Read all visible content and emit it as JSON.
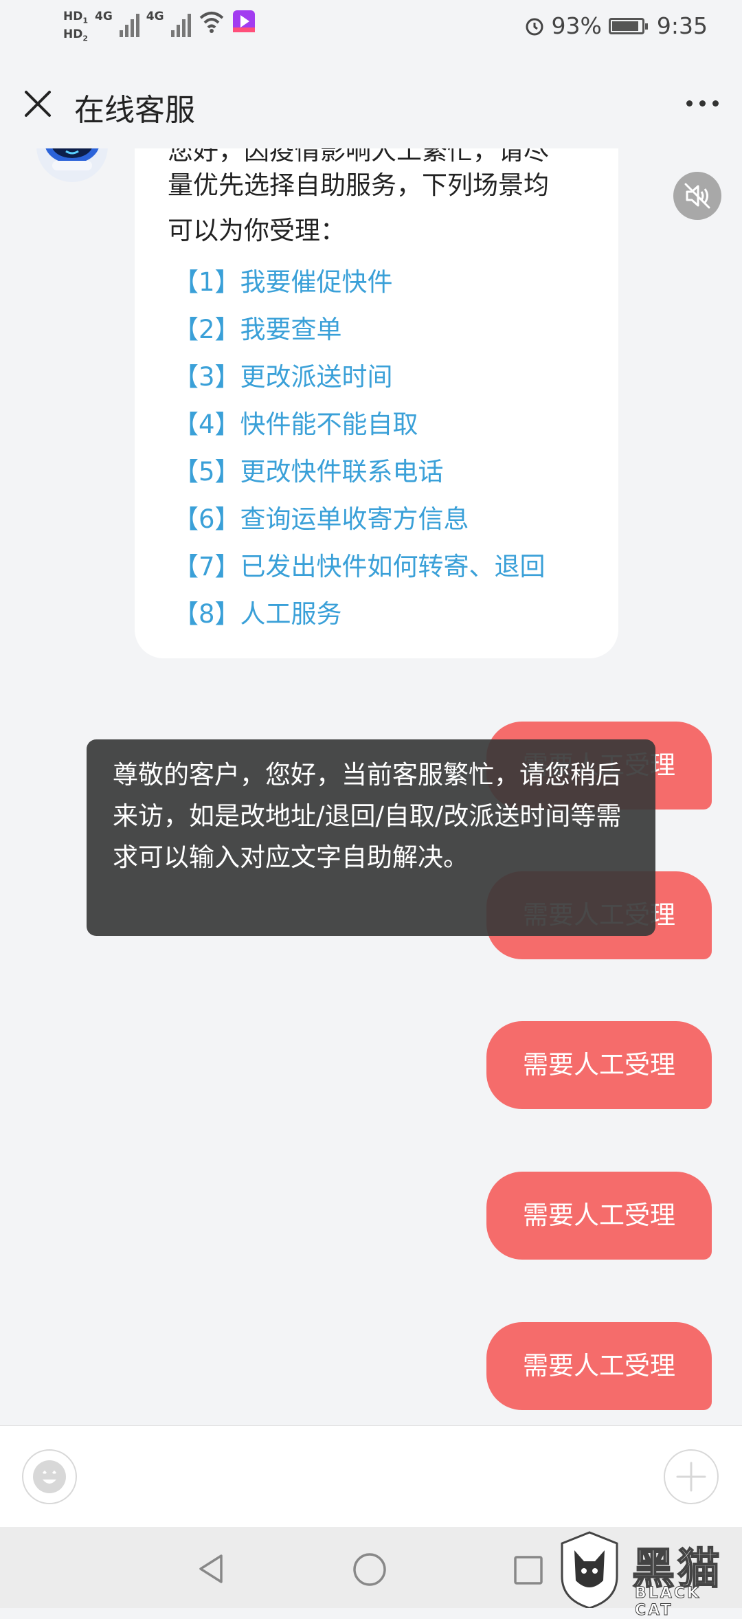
{
  "status_bar": {
    "hd1": "HD",
    "hd1_sub": "1",
    "hd2": "HD",
    "hd2_sub": "2",
    "net1": "4G",
    "net2": "4G",
    "alarm_icon": "alarm-icon",
    "battery_percent": "93%",
    "time": "9:35"
  },
  "header": {
    "close_icon": "close-icon",
    "title": "在线客服",
    "more_icon": "more-icon"
  },
  "bot_message": {
    "partial_line": "您好，因疫情影响人工繁忙，请尽",
    "line2": "量优先选择自助服务，下列场景均",
    "line3": "可以为你受理：",
    "menu": [
      "【1】我要催促快件",
      "【2】我要查单",
      "【3】更改派送时间",
      "【4】快件能不能自取",
      "【5】更改快件联系电话",
      "【6】查询运单收寄方信息",
      "【7】已发出快件如何转寄、退回",
      "【8】人工服务"
    ]
  },
  "user_messages": [
    "需要人工受理",
    "需要人工受理",
    "需要人工受理",
    "需要人工受理",
    "需要人工受理"
  ],
  "toast": {
    "text": "尊敬的客户，您好，当前客服繁忙，请您稍后来访，如是改地址/退回/自取/改派送时间等需求可以输入对应文字自助解决。"
  },
  "input_bar": {
    "emoji_icon": "emoji-icon",
    "plus_icon": "plus-icon"
  },
  "nav_bar": {
    "back_icon": "back-icon",
    "home_icon": "home-icon",
    "recents_icon": "recents-icon"
  },
  "watermark": {
    "title": "黑猫",
    "subtitle": "BLACK CAT"
  },
  "colors": {
    "accent_link": "#3aa0d8",
    "user_bubble": "#f56c6b",
    "background": "#f3f4f6"
  }
}
